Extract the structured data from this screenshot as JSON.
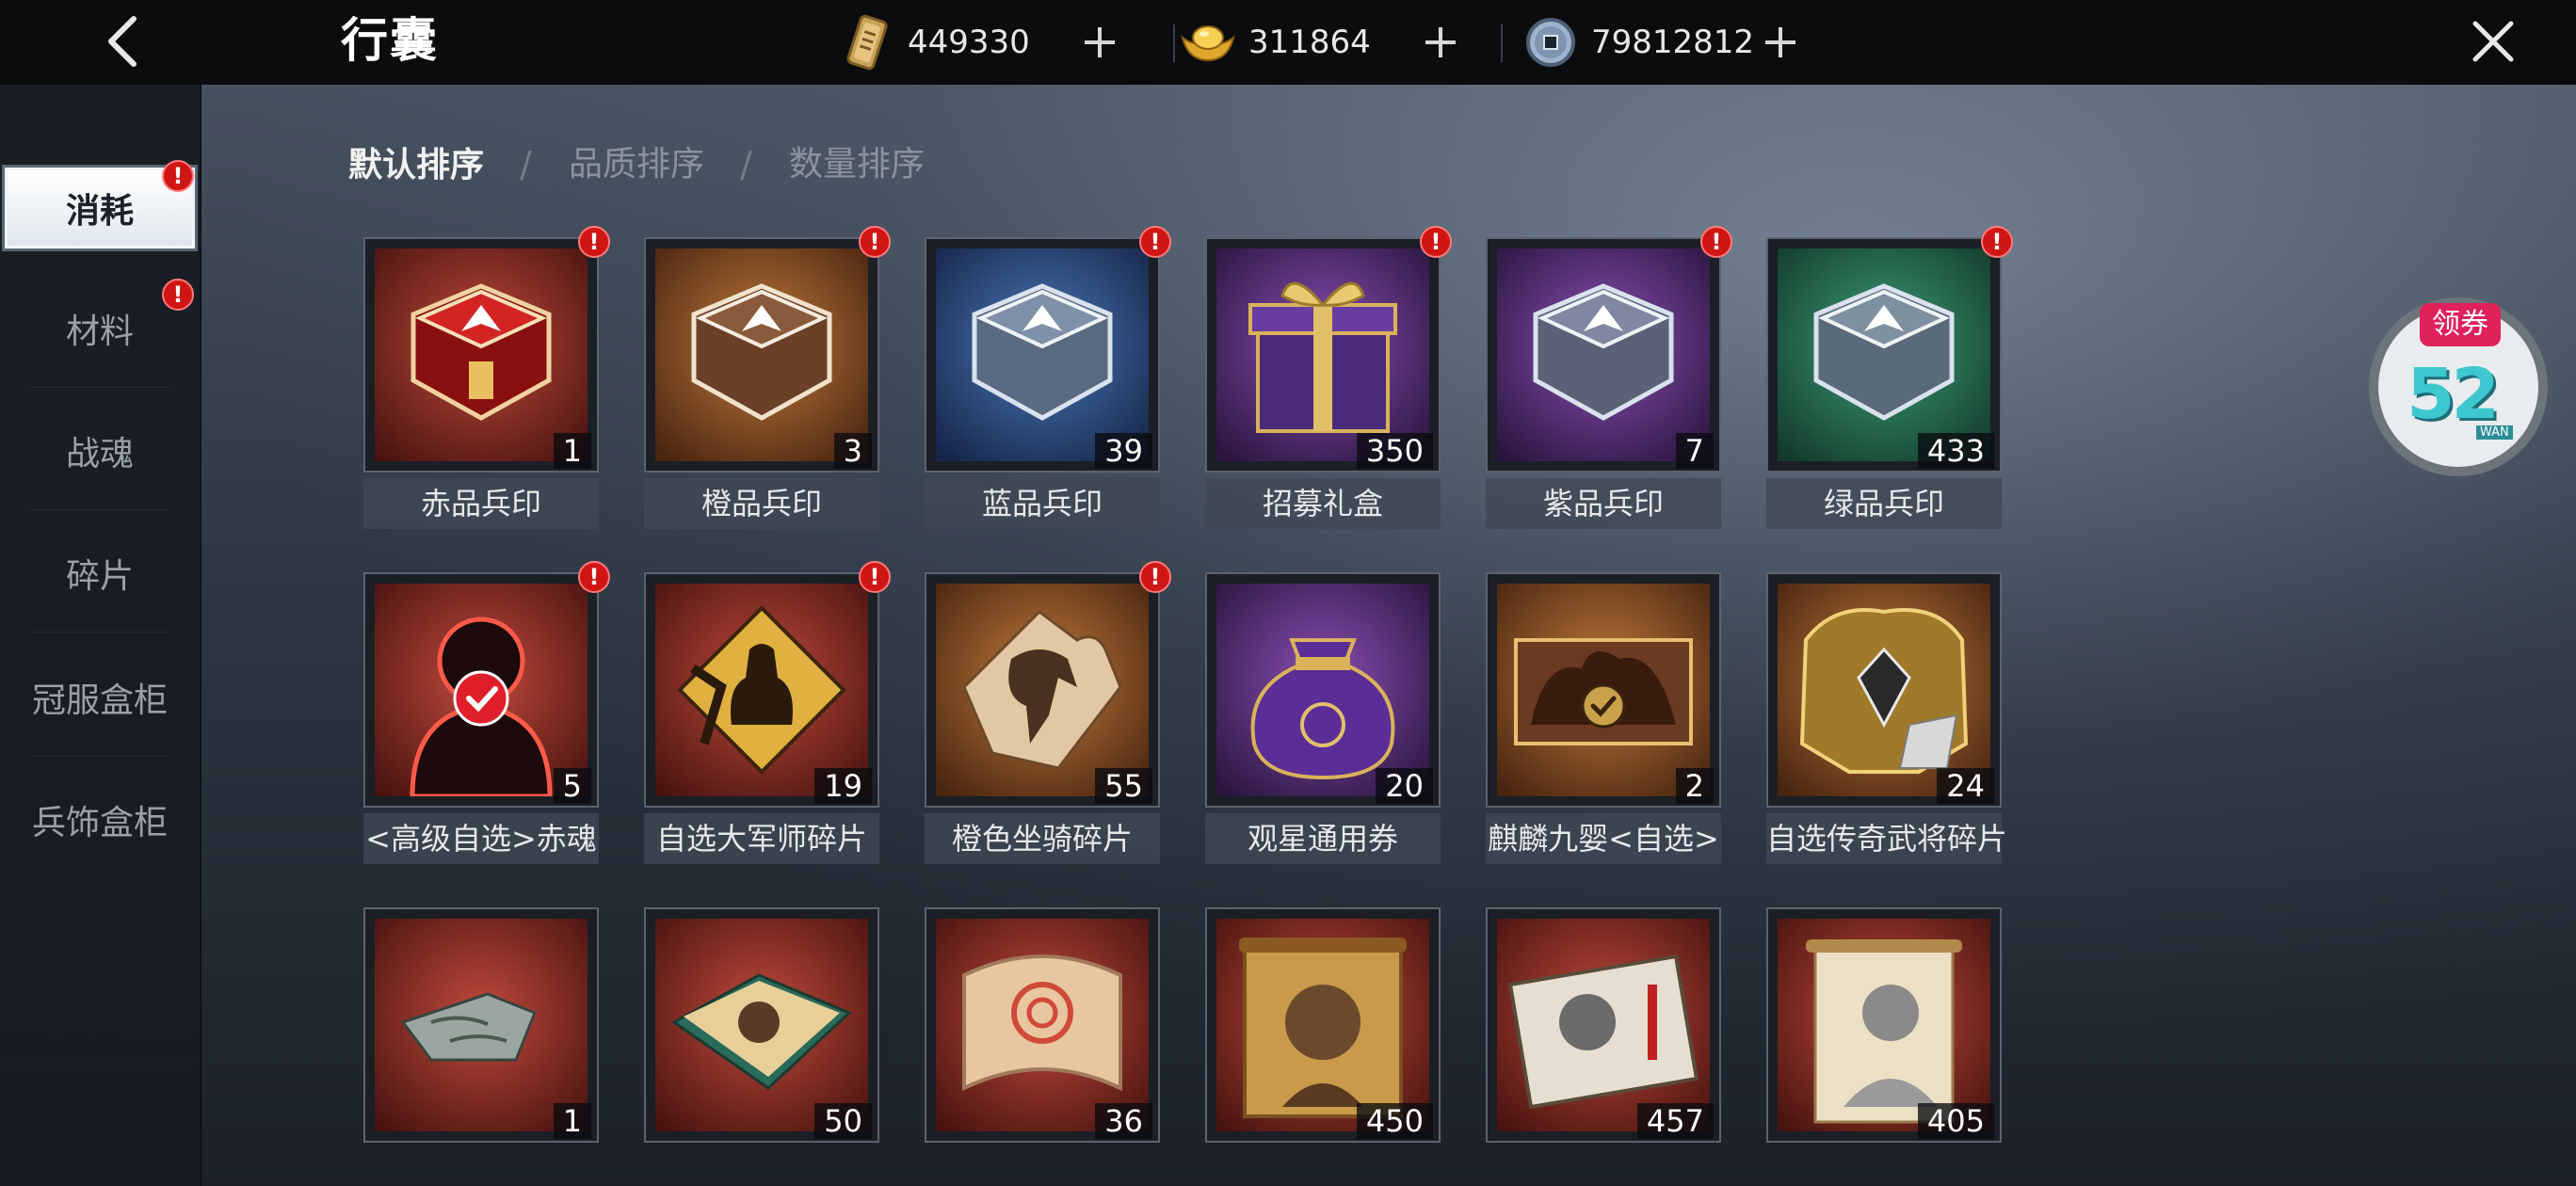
{
  "header": {
    "title": "行囊",
    "currencies": [
      {
        "icon": "token-icon",
        "value": "449330"
      },
      {
        "icon": "gold-ingot-icon",
        "value": "311864"
      },
      {
        "icon": "copper-coin-icon",
        "value": "79812812"
      }
    ]
  },
  "sidebar": {
    "items": [
      {
        "label": "消耗",
        "active": true,
        "badge": "!"
      },
      {
        "label": "材料",
        "active": false,
        "badge": "!"
      },
      {
        "label": "战魂",
        "active": false
      },
      {
        "label": "碎片",
        "active": false
      },
      {
        "label": "冠服盒柜",
        "active": false
      },
      {
        "label": "兵饰盒柜",
        "active": false
      }
    ]
  },
  "sort": {
    "options": [
      "默认排序",
      "品质排序",
      "数量排序"
    ],
    "separator": "/",
    "active": "默认排序"
  },
  "badge_text": "!",
  "items": [
    {
      "name": "赤品兵印",
      "count": "1",
      "badge": true,
      "icon": "red-seal-chest-icon"
    },
    {
      "name": "橙品兵印",
      "count": "3",
      "badge": true,
      "icon": "orange-seal-chest-icon"
    },
    {
      "name": "蓝品兵印",
      "count": "39",
      "badge": true,
      "icon": "blue-seal-chest-icon"
    },
    {
      "name": "招募礼盒",
      "count": "350",
      "badge": true,
      "icon": "gift-box-icon"
    },
    {
      "name": "紫品兵印",
      "count": "7",
      "badge": true,
      "icon": "purple-seal-chest-icon"
    },
    {
      "name": "绿品兵印",
      "count": "433",
      "badge": true,
      "icon": "green-seal-chest-icon"
    },
    {
      "name": "<高级自选>赤魂",
      "count": "5",
      "badge": true,
      "icon": "red-soul-icon"
    },
    {
      "name": "自选大军师碎片",
      "count": "19",
      "badge": true,
      "icon": "strategist-fragment-icon"
    },
    {
      "name": "橙色坐骑碎片",
      "count": "55",
      "badge": true,
      "icon": "mount-fragment-icon"
    },
    {
      "name": "观星通用券",
      "count": "20",
      "badge": false,
      "icon": "lucky-bag-icon"
    },
    {
      "name": "麒麟九婴<自选>",
      "count": "2",
      "badge": false,
      "icon": "qilin-select-icon"
    },
    {
      "name": "自选传奇武将碎片",
      "count": "24",
      "badge": false,
      "icon": "legend-general-fragment-icon"
    },
    {
      "name": "",
      "count": "1",
      "badge": false,
      "icon": "jade-stone-icon"
    },
    {
      "name": "",
      "count": "50",
      "badge": false,
      "icon": "portrait-book-icon"
    },
    {
      "name": "",
      "count": "36",
      "badge": false,
      "icon": "pattern-scroll-icon"
    },
    {
      "name": "",
      "count": "450",
      "badge": false,
      "icon": "general-scroll-icon"
    },
    {
      "name": "",
      "count": "457",
      "badge": false,
      "icon": "sketch-book-icon"
    },
    {
      "name": "",
      "count": "405",
      "badge": false,
      "icon": "hanging-scroll-icon"
    }
  ],
  "coupon": {
    "tag": "领券",
    "number": "52",
    "sub": "WAN"
  }
}
